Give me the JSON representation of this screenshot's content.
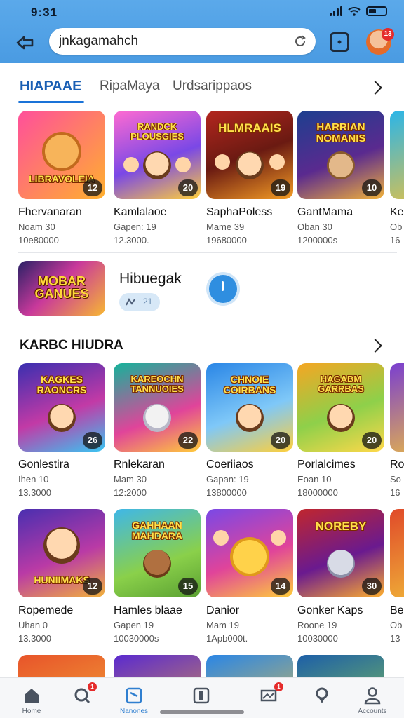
{
  "status_bar": {
    "time": "9:31"
  },
  "search": {
    "value": "jnkagamahch"
  },
  "avatar": {
    "badge": "13"
  },
  "tabs": [
    {
      "label": "HIAPAAE",
      "active": true
    },
    {
      "label": "RipaMaya",
      "active": false
    },
    {
      "label": "Urdsarippaos",
      "active": false
    }
  ],
  "row1": [
    {
      "thumb_title": "LIBRAVOLEIA",
      "badge": "12",
      "name": "Fhervanaran",
      "sub": "Noam 30",
      "meta": "10e80000"
    },
    {
      "thumb_title": "RANDCK PLOUSGIES",
      "badge": "20",
      "name": "Kamlalaoe",
      "sub": "Gapen: 19",
      "meta": "12.3000."
    },
    {
      "thumb_title": "HLMRAAIS",
      "badge": "19",
      "name": "SaphaPoless",
      "sub": "Mame 39",
      "meta": "19680000"
    },
    {
      "thumb_title": "HARRIAN NOMANIS",
      "badge": "10",
      "name": "GantMama",
      "sub": "Oban 30",
      "meta": "1200000s"
    },
    {
      "thumb_title": "",
      "badge": "",
      "name": "Ke",
      "sub": "Ob",
      "meta": "16"
    }
  ],
  "featured": {
    "thumb_title": "MOBAR GANUES",
    "title": "Hibuegak",
    "pill_text": "21"
  },
  "section2": {
    "title": "KARBC HIUDRA"
  },
  "row2": [
    {
      "thumb_title": "KAGKES RAONCRS",
      "badge": "26",
      "name": "Gonlestira",
      "sub": "Ihen 10",
      "meta": "13.3000"
    },
    {
      "thumb_title": "KAREOCHN TANNUOIES",
      "badge": "22",
      "name": "Rnlekaran",
      "sub": "Mam 30",
      "meta": "12:2000"
    },
    {
      "thumb_title": "CHNOIE COIRBANS",
      "badge": "20",
      "name": "Coeriiaos",
      "sub": "Gapan: 19",
      "meta": "13800000"
    },
    {
      "thumb_title": "HAGABM GARRBAS",
      "badge": "20",
      "name": "Porlalcimes",
      "sub": "Eoan 10",
      "meta": "18000000"
    },
    {
      "thumb_title": "",
      "badge": "",
      "name": "Ro",
      "sub": "So",
      "meta": "16"
    }
  ],
  "row3": [
    {
      "thumb_title": "HUNIIMAKS",
      "badge": "12",
      "name": "Ropemede",
      "sub": "Uhan 0",
      "meta": "13.3000"
    },
    {
      "thumb_title": "GAHHAAN MAHDARA",
      "badge": "15",
      "name": "Hamles blaae",
      "sub": "Gapen 19",
      "meta": "10030000s"
    },
    {
      "thumb_title": "",
      "badge": "14",
      "name": "Danior",
      "sub": "Mam 19",
      "meta": "1Apb000t."
    },
    {
      "thumb_title": "NOREBY",
      "badge": "30",
      "name": "Gonker Kaps",
      "sub": "Roone 19",
      "meta": "10030000"
    },
    {
      "thumb_title": "",
      "badge": "",
      "name": "Be",
      "sub": "Ob",
      "meta": "13"
    }
  ],
  "bottom_nav": [
    {
      "label": "Home",
      "icon": "home-icon",
      "badge": ""
    },
    {
      "label": "",
      "icon": "search-icon",
      "badge": "1"
    },
    {
      "label": "Nanones",
      "icon": "games-icon",
      "badge": ""
    },
    {
      "label": "",
      "icon": "library-icon",
      "badge": ""
    },
    {
      "label": "",
      "icon": "messages-icon",
      "badge": "1"
    },
    {
      "label": "",
      "icon": "location-icon",
      "badge": ""
    },
    {
      "label": "Accounts",
      "icon": "person-icon",
      "badge": ""
    }
  ],
  "colors": {
    "header": "#4a9be2",
    "accent": "#1a73d8",
    "badge": "#e52b2b"
  }
}
